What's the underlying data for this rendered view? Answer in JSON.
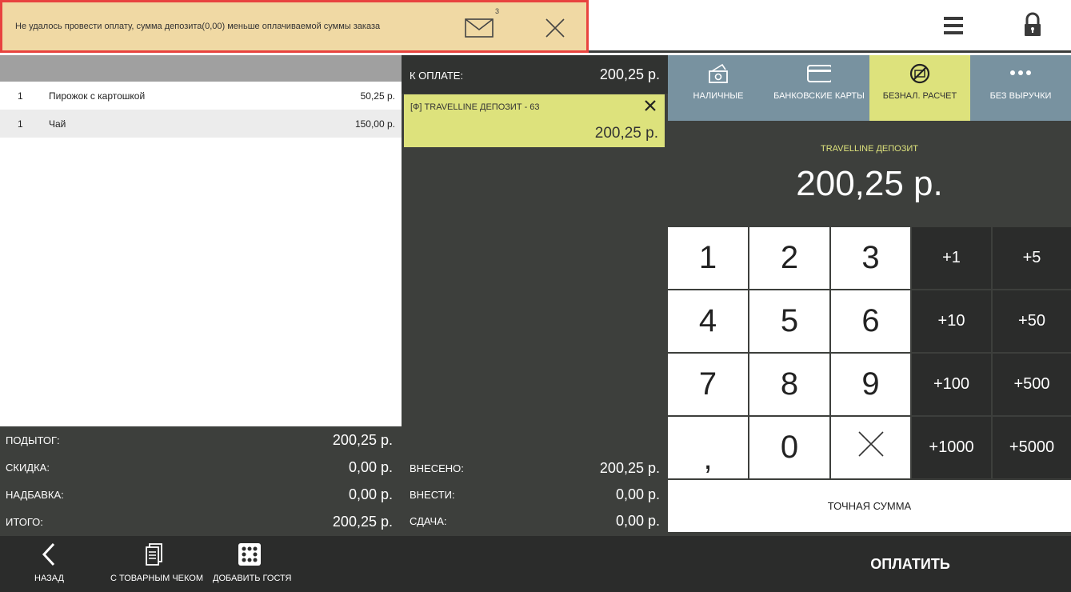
{
  "alert": {
    "message": "Не удалось провести оплату, сумма депозита(0,00) меньше оплачиваемой суммы заказа",
    "count": "3",
    "icons": [
      "mail-icon",
      "close-icon"
    ]
  },
  "header": {
    "icons": [
      "menu-icon",
      "lock-icon"
    ]
  },
  "order": {
    "items": [
      {
        "qty": "1",
        "name": "Пирожок с картошкой",
        "price": "50,25 р."
      },
      {
        "qty": "1",
        "name": "Чай",
        "price": "150,00 р."
      }
    ],
    "totals": [
      {
        "label": "ПОДЫТОГ:",
        "value": "200,25 р."
      },
      {
        "label": "СКИДКА:",
        "value": "0,00 р."
      },
      {
        "label": "НАДБАВКА:",
        "value": "0,00 р."
      },
      {
        "label": "ИТОГО:",
        "value": "200,25 р."
      }
    ]
  },
  "payment": {
    "to_pay_label": "К ОПЛАТЕ:",
    "to_pay_value": "200,25 р.",
    "card_name": "[Ф] TRAVELLINE ДЕПОЗИТ - 63",
    "card_amount": "200,25 р.",
    "footer": [
      {
        "label": "ВНЕСЕНО:",
        "value": "200,25 р."
      },
      {
        "label": "ВНЕСТИ:",
        "value": "0,00 р."
      },
      {
        "label": "СДАЧА:",
        "value": "0,00 р."
      }
    ]
  },
  "methods": {
    "tabs": [
      {
        "label": "НАЛИЧНЫЕ",
        "icon": "cash-icon",
        "active": false
      },
      {
        "label": "БАНКОВСКИЕ КАРТЫ",
        "icon": "card-icon",
        "active": false
      },
      {
        "label": "БЕЗНАЛ. РАСЧЕТ",
        "icon": "no-cash-icon",
        "active": true
      },
      {
        "label": "БЕЗ ВЫРУЧКИ",
        "icon": "more-icon",
        "active": false
      }
    ],
    "selected_name": "TRAVELLINE ДЕПОЗИТ",
    "selected_amount": "200,25 р."
  },
  "keypad": {
    "numbers": [
      "1",
      "2",
      "3",
      "4",
      "5",
      "6",
      "7",
      "8",
      "9",
      ",",
      "0",
      "backspace-icon"
    ],
    "quick_add": [
      "+1",
      "+5",
      "+10",
      "+50",
      "+100",
      "+500",
      "+1000",
      "+5000"
    ],
    "exact_label": "ТОЧНАЯ СУММА"
  },
  "bottom": {
    "back_label": "НАЗАД",
    "receipt_label": "С ТОВАРНЫМ ЧЕКОМ",
    "guest_label": "ДОБАВИТЬ ГОСТЯ",
    "pay_label": "ОПЛАТИТЬ"
  },
  "colors": {
    "alert_bg": "#f0d9a4",
    "alert_border": "#e8433f",
    "accent": "#dde27c",
    "tab_bg": "#7892a0",
    "panel_dark": "#3d3f3c",
    "bar_dark": "#2b2c2b"
  }
}
